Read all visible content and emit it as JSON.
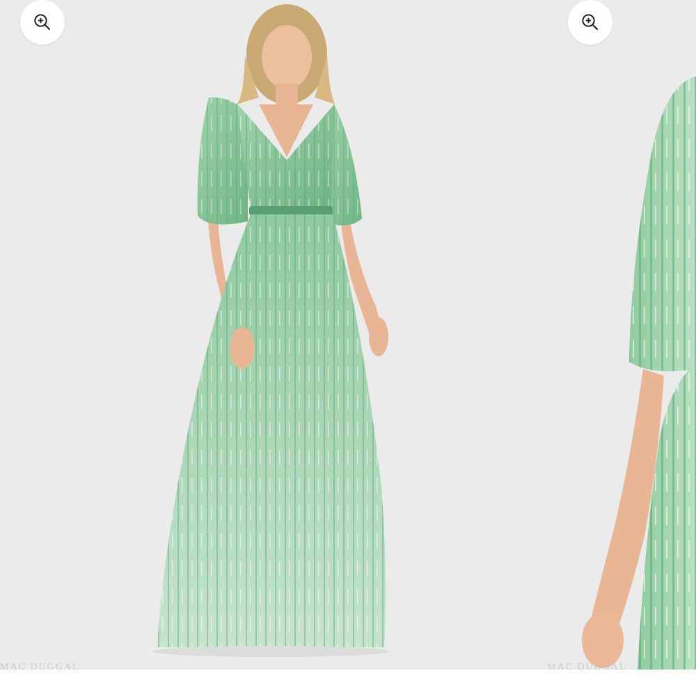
{
  "carousel": {
    "slides": [
      {
        "watermark": "MAC DUGGAL",
        "zoom_icon": "zoom-in-icon"
      },
      {
        "watermark": "MAC DUGGAL",
        "zoom_icon": "zoom-in-icon"
      }
    ]
  },
  "colors": {
    "background": "#ebebeb",
    "dress_green": "#9fd1a9",
    "sequin_dark": "#4f9c68",
    "skin": "#e8b694",
    "hair": "#c9a874"
  }
}
